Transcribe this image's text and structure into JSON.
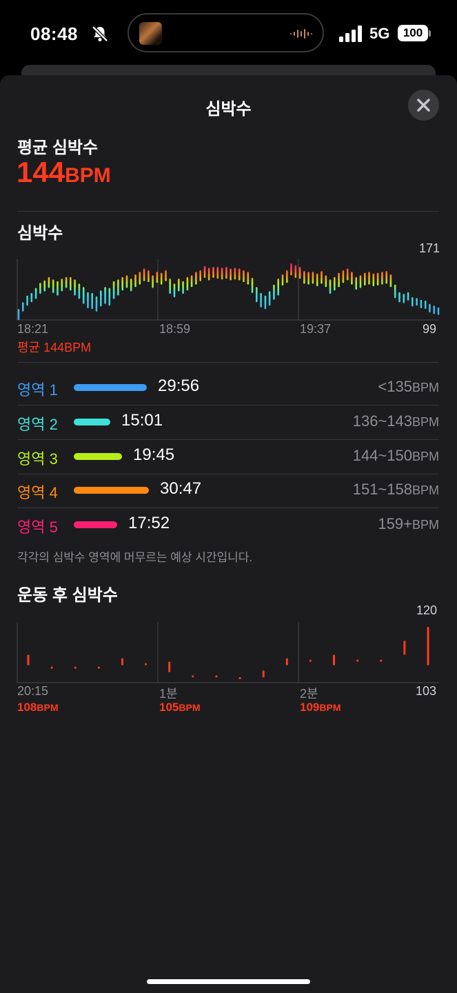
{
  "status_bar": {
    "time": "08:48",
    "network": "5G",
    "battery": "100",
    "icons": [
      "bell-slash-icon",
      "album-art",
      "audio-waveform-icon",
      "cellular-signal-icon",
      "battery-icon"
    ]
  },
  "sheet": {
    "title": "심박수",
    "close_icon": "xmark-icon"
  },
  "average": {
    "label": "평균 심박수",
    "value": "144",
    "unit": "BPM"
  },
  "heart_rate_chart": {
    "title": "심박수",
    "y_max_label": "171",
    "y_min_label": "99",
    "x_labels": [
      "18:21",
      "18:59",
      "19:37"
    ],
    "avg_note": "평균 144BPM"
  },
  "zones": [
    {
      "name": "영역 1",
      "time": "29:56",
      "range": "<135",
      "unit": "BPM",
      "color": "#3d9bf2",
      "fraction": 0.2995
    },
    {
      "name": "영역 2",
      "time": "15:01",
      "range": "136~143",
      "unit": "BPM",
      "color": "#40e0d8",
      "fraction": 0.1502
    },
    {
      "name": "영역 3",
      "time": "19:45",
      "range": "144~150",
      "unit": "BPM",
      "color": "#b6ee1a",
      "fraction": 0.1975
    },
    {
      "name": "영역 4",
      "time": "30:47",
      "range": "151~158",
      "unit": "BPM",
      "color": "#ff8a0f",
      "fraction": 0.3078
    },
    {
      "name": "영역 5",
      "time": "17:52",
      "range": "159+",
      "unit": "BPM",
      "color": "#ff1f72",
      "fraction": 0.1787
    }
  ],
  "zone_note": "각각의 심박수 영역에 머무르는 예상 시간입니다.",
  "recovery": {
    "title": "운동 후 심박수",
    "y_max_label": "120",
    "y_min_label": "103",
    "x_labels": [
      "20:15",
      "1분",
      "2분"
    ],
    "values": [
      {
        "num": "108",
        "unit": "BPM"
      },
      {
        "num": "105",
        "unit": "BPM"
      },
      {
        "num": "109",
        "unit": "BPM"
      }
    ]
  },
  "colors": {
    "accent_red": "#ff3b1f",
    "zone1": "#3d9bf2",
    "zone2": "#40e0d8",
    "zone3": "#b6ee1a",
    "zone4": "#ff8a0f",
    "zone5": "#ff1f72"
  },
  "chart_data": [
    {
      "type": "bar",
      "title": "심박수",
      "x_ticks": [
        "18:21",
        "18:59",
        "19:37"
      ],
      "ylim": [
        99,
        171
      ],
      "note": "range bars (min-max bpm per interval), colored by heart rate zone",
      "series": [
        {
          "ranges": [
            [
              99,
              112
            ],
            [
              109,
              120
            ],
            [
              116,
              128
            ],
            [
              120,
              131
            ],
            [
              124,
              137
            ],
            [
              130,
              143
            ],
            [
              133,
              146
            ],
            [
              137,
              150
            ],
            [
              131,
              147
            ],
            [
              128,
              145
            ],
            [
              133,
              148
            ],
            [
              137,
              150
            ],
            [
              134,
              150
            ],
            [
              128,
              147
            ],
            [
              124,
              142
            ],
            [
              118,
              138
            ],
            [
              113,
              132
            ],
            [
              112,
              131
            ],
            [
              109,
              127
            ],
            [
              115,
              134
            ],
            [
              118,
              138
            ],
            [
              116,
              137
            ],
            [
              124,
              145
            ],
            [
              128,
              147
            ],
            [
              134,
              150
            ],
            [
              137,
              152
            ],
            [
              133,
              148
            ],
            [
              138,
              153
            ],
            [
              141,
              156
            ],
            [
              145,
              160
            ],
            [
              144,
              158
            ],
            [
              137,
              152
            ],
            [
              143,
              156
            ],
            [
              141,
              155
            ],
            [
              145,
              158
            ],
            [
              130,
              148
            ],
            [
              126,
              142
            ],
            [
              133,
              148
            ],
            [
              130,
              145
            ],
            [
              134,
              150
            ],
            [
              138,
              152
            ],
            [
              141,
              156
            ],
            [
              145,
              158
            ],
            [
              149,
              163
            ],
            [
              146,
              161
            ],
            [
              149,
              162
            ],
            [
              148,
              162
            ],
            [
              147,
              161
            ],
            [
              148,
              162
            ],
            [
              146,
              160
            ],
            [
              147,
              161
            ],
            [
              146,
              160
            ],
            [
              144,
              158
            ],
            [
              141,
              156
            ],
            [
              131,
              149
            ],
            [
              120,
              138
            ],
            [
              114,
              131
            ],
            [
              112,
              128
            ],
            [
              116,
              133
            ],
            [
              123,
              141
            ],
            [
              128,
              148
            ],
            [
              140,
              153
            ],
            [
              143,
              158
            ],
            [
              152,
              166
            ],
            [
              149,
              164
            ],
            [
              148,
              162
            ],
            [
              142,
              157
            ],
            [
              141,
              156
            ],
            [
              142,
              156
            ],
            [
              139,
              154
            ],
            [
              142,
              157
            ],
            [
              138,
              152
            ],
            [
              130,
              147
            ],
            [
              134,
              150
            ],
            [
              138,
              155
            ],
            [
              143,
              158
            ],
            [
              146,
              160
            ],
            [
              141,
              156
            ],
            [
              135,
              150
            ],
            [
              137,
              152
            ],
            [
              140,
              155
            ],
            [
              141,
              156
            ],
            [
              139,
              154
            ],
            [
              140,
              155
            ],
            [
              141,
              156
            ],
            [
              142,
              157
            ],
            [
              138,
              153
            ],
            [
              125,
              141
            ],
            [
              120,
              132
            ],
            [
              119,
              130
            ],
            [
              122,
              132
            ],
            [
              115,
              126
            ],
            [
              116,
              125
            ],
            [
              113,
              123
            ],
            [
              112,
              122
            ],
            [
              108,
              118
            ],
            [
              106,
              116
            ],
            [
              105,
              114
            ]
          ]
        }
      ]
    },
    {
      "type": "bar",
      "title": "운동 후 심박수",
      "x_ticks": [
        "20:15",
        "1분",
        "2분"
      ],
      "ylim": [
        103,
        120
      ],
      "note": "post-workout heart rate range bars",
      "series": [
        {
          "ranges": [
            [
              108,
              111
            ],
            [
              107,
              107.6
            ],
            [
              107,
              107.6
            ],
            [
              107,
              107.6
            ],
            [
              108,
              110
            ],
            [
              108,
              108.6
            ],
            [
              106,
              109
            ],
            [
              104.5,
              105.1
            ],
            [
              104.5,
              105.1
            ],
            [
              104,
              104.6
            ],
            [
              104.5,
              106.5
            ],
            [
              108,
              110
            ],
            [
              109,
              109.6
            ],
            [
              108,
              111
            ],
            [
              109,
              109.6
            ],
            [
              109,
              109.6
            ],
            [
              111,
              115
            ],
            [
              108,
              119
            ]
          ]
        }
      ]
    }
  ]
}
